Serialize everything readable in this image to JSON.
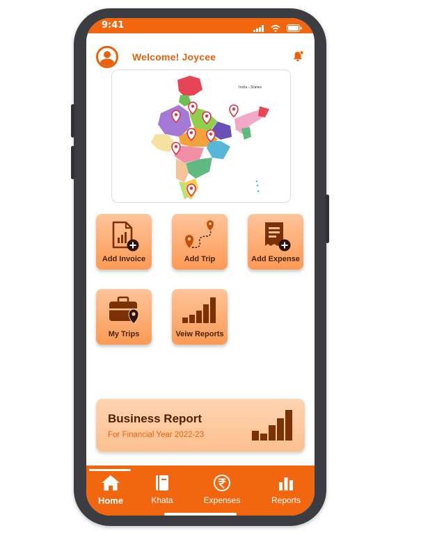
{
  "status_bar": {
    "time": "9:41"
  },
  "header": {
    "welcome_text": "Welcome! Joycee"
  },
  "map": {
    "title": "India - States"
  },
  "tiles": [
    {
      "label": "Add Invoice",
      "icon": "invoice-add-icon"
    },
    {
      "label": "Add Trip",
      "icon": "route-pin-icon"
    },
    {
      "label": "Add Expense",
      "icon": "receipt-add-icon"
    },
    {
      "label": "My Trips",
      "icon": "briefcase-pin-icon"
    },
    {
      "label": "Veiw Reports",
      "icon": "bar-chart-icon"
    }
  ],
  "report_card": {
    "title": "Business Report",
    "subtitle": "For Financial Year 2022-23"
  },
  "bottom_nav": [
    {
      "label": "Home",
      "icon": "home-icon",
      "active": true
    },
    {
      "label": "Khata",
      "icon": "book-icon",
      "active": false
    },
    {
      "label": "Expenses",
      "icon": "rupee-icon",
      "active": false
    },
    {
      "label": "Reports",
      "icon": "bar-chart-icon",
      "active": false
    }
  ],
  "colors": {
    "accent": "#f2660f",
    "tile_top": "#ffc49a",
    "tile_bottom": "#fb9a55",
    "text_dark": "#4a2208"
  }
}
